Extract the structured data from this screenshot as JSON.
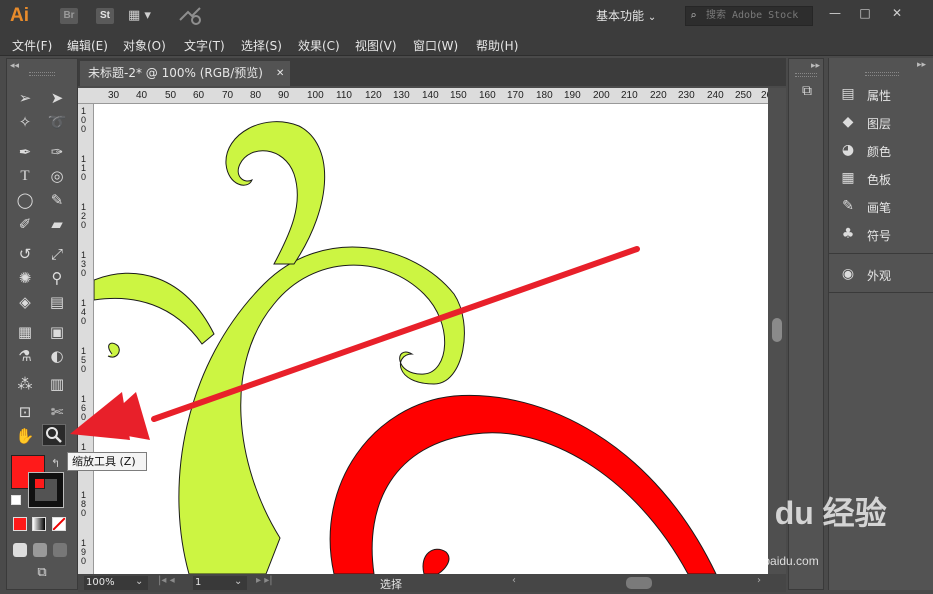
{
  "app": {
    "logo": "Ai",
    "bridge": "Br",
    "stock": "St",
    "workspace": "基本功能",
    "search_placeholder": "搜索 Adobe Stock",
    "minimize": "—",
    "maximize": "□",
    "close": "✕"
  },
  "menu": [
    "文件(F)",
    "编辑(E)",
    "对象(O)",
    "文字(T)",
    "选择(S)",
    "效果(C)",
    "视图(V)",
    "窗口(W)",
    "帮助(H)"
  ],
  "document": {
    "tab_label": "未标题-2* @ 100% (RGB/预览)",
    "close_symbol": "✕"
  },
  "ruler": {
    "h_ticks": [
      "30",
      "40",
      "50",
      "60",
      "70",
      "80",
      "90",
      "100",
      "110",
      "120",
      "130",
      "140",
      "150",
      "160",
      "170",
      "180",
      "190",
      "200",
      "210",
      "220",
      "230",
      "240",
      "250",
      "26"
    ],
    "v_ticks": [
      "1",
      "0",
      "0",
      "1",
      "1",
      "0",
      "1",
      "2",
      "0",
      "1",
      "3",
      "0",
      "1",
      "4",
      "0",
      "1",
      "5",
      "0",
      "1",
      "6",
      "0",
      "1",
      "7",
      "0",
      "1",
      "8",
      "0",
      "1",
      "9",
      "0",
      "2",
      "0",
      "0",
      "2",
      "1",
      "0",
      "2",
      "2",
      "0",
      "2",
      "3",
      "0"
    ]
  },
  "tooltip": "缩放工具 (Z)",
  "status": {
    "zoom": "100%",
    "page": "1",
    "tool": "选择"
  },
  "panels": [
    {
      "label": "属性",
      "icon": "properties-icon"
    },
    {
      "label": "图层",
      "icon": "layers-icon"
    },
    {
      "label": "颜色",
      "icon": "color-icon"
    },
    {
      "label": "色板",
      "icon": "swatches-icon"
    },
    {
      "label": "画笔",
      "icon": "brushes-icon"
    },
    {
      "label": "符号",
      "icon": "symbols-icon"
    },
    {
      "label": "外观",
      "icon": "appearance-icon"
    }
  ],
  "colors": {
    "fill": "#ff1a1a",
    "vine_green": "#ccf542",
    "shape_red": "#ff0000",
    "arrow_red": "#e8202a"
  },
  "watermark": {
    "brand": "Bai du 经验",
    "url": "jingyan.baidu.com"
  }
}
